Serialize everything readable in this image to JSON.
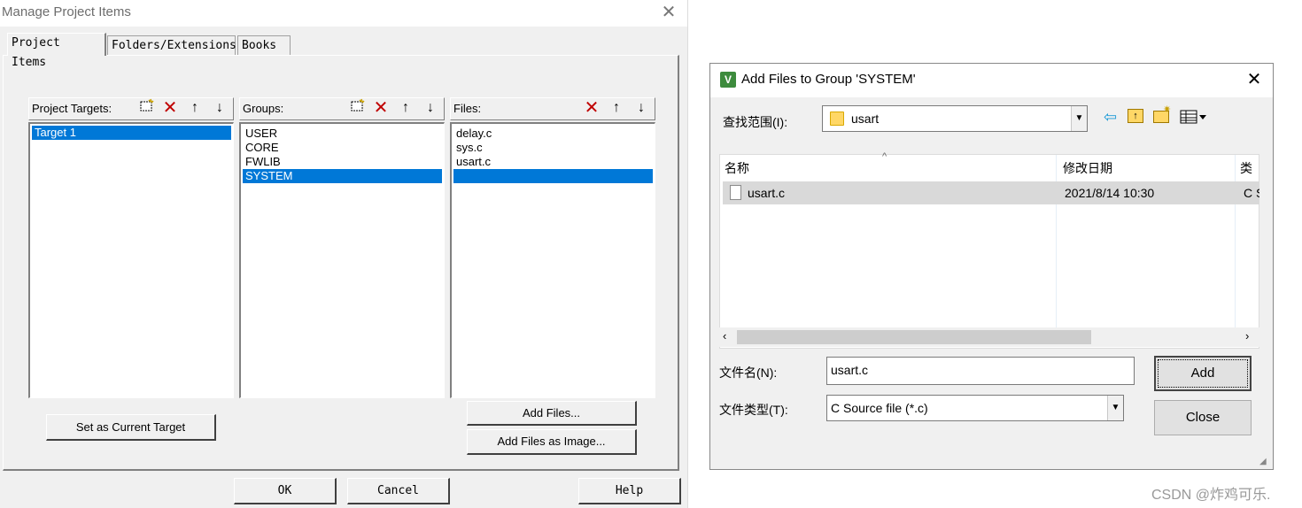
{
  "left_dialog": {
    "title": "Manage Project Items",
    "close_glyph": "✕",
    "tabs": [
      "Project Items",
      "Folders/Extensions",
      "Books"
    ],
    "targets": {
      "header": "Project Targets:",
      "items": [
        "Target 1"
      ]
    },
    "groups": {
      "header": "Groups:",
      "items": [
        "USER",
        "CORE",
        "FWLIB",
        "SYSTEM"
      ]
    },
    "files": {
      "header": "Files:",
      "items": [
        "delay.c",
        "sys.c",
        "usart.c"
      ]
    },
    "buttons": {
      "set_current": "Set as Current Target",
      "add_files": "Add Files...",
      "add_files_image": "Add Files as Image...",
      "ok": "OK",
      "cancel": "Cancel",
      "help": "Help"
    }
  },
  "right_dialog": {
    "title": "Add Files to Group 'SYSTEM'",
    "look_in_label": "查找范围(I):",
    "look_in_value": "usart",
    "columns": [
      "名称",
      "修改日期",
      "类"
    ],
    "rows": [
      {
        "name": "usart.c",
        "date": "2021/8/14 10:30",
        "type": "C S"
      }
    ],
    "filename_label": "文件名(N):",
    "filename_value": "usart.c",
    "filetype_label": "文件类型(T):",
    "filetype_value": "C Source file (*.c)",
    "add_button": "Add",
    "close_button": "Close"
  },
  "watermark": "CSDN @炸鸡可乐.",
  "colors": {
    "selection": "#0078d7",
    "delete_icon": "#c00000",
    "folder": "#ffd766"
  },
  "icons": [
    "new-item-icon",
    "delete-icon",
    "move-up-icon",
    "move-down-icon",
    "app-icon",
    "back-icon",
    "up-folder-icon",
    "new-folder-icon",
    "view-menu-icon",
    "folder-icon",
    "file-icon",
    "sort-up-icon",
    "scroll-left-icon",
    "scroll-right-icon",
    "resize-grip-icon"
  ]
}
